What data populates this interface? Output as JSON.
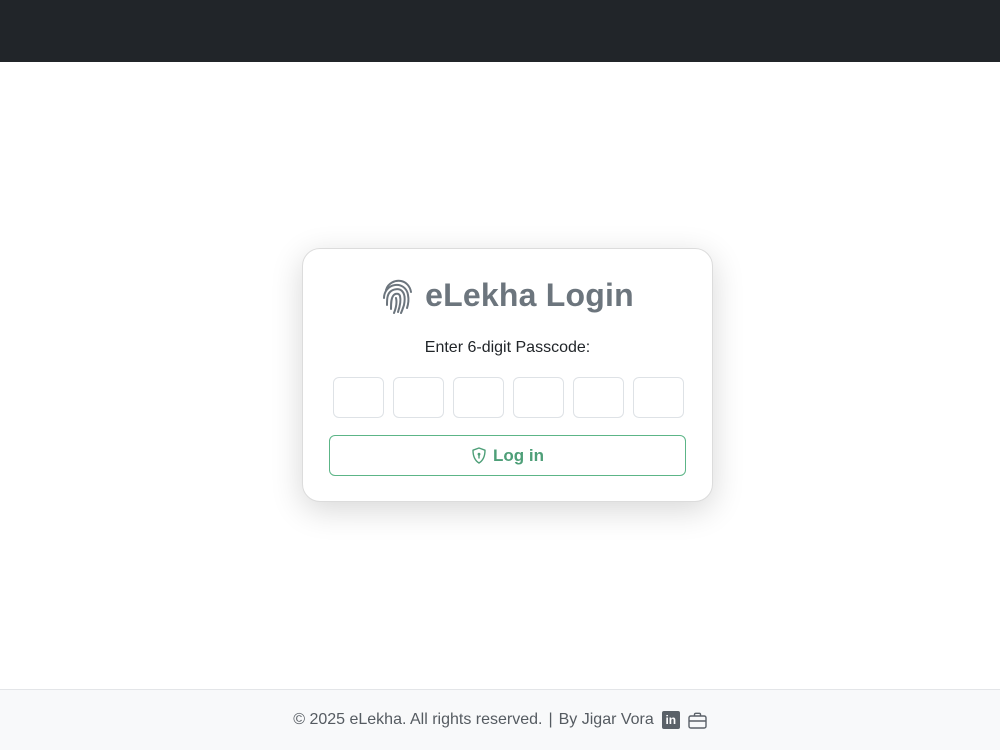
{
  "header": {},
  "login": {
    "title": "eLekha Login",
    "prompt": "Enter 6-digit Passcode:",
    "digits": [
      "",
      "",
      "",
      "",
      "",
      ""
    ],
    "button_label": "Log in"
  },
  "footer": {
    "copyright": "© 2025 eLekha. All rights reserved.",
    "separator": "|",
    "author": "By Jigar Vora",
    "linkedin_icon_text": "in"
  },
  "colors": {
    "topbar": "#212529",
    "accent": "#5cb587",
    "title": "#6c757d"
  },
  "icons": {
    "title": "fingerprint-icon",
    "button": "shield-icon",
    "footer": [
      "linkedin-icon",
      "briefcase-icon"
    ]
  }
}
